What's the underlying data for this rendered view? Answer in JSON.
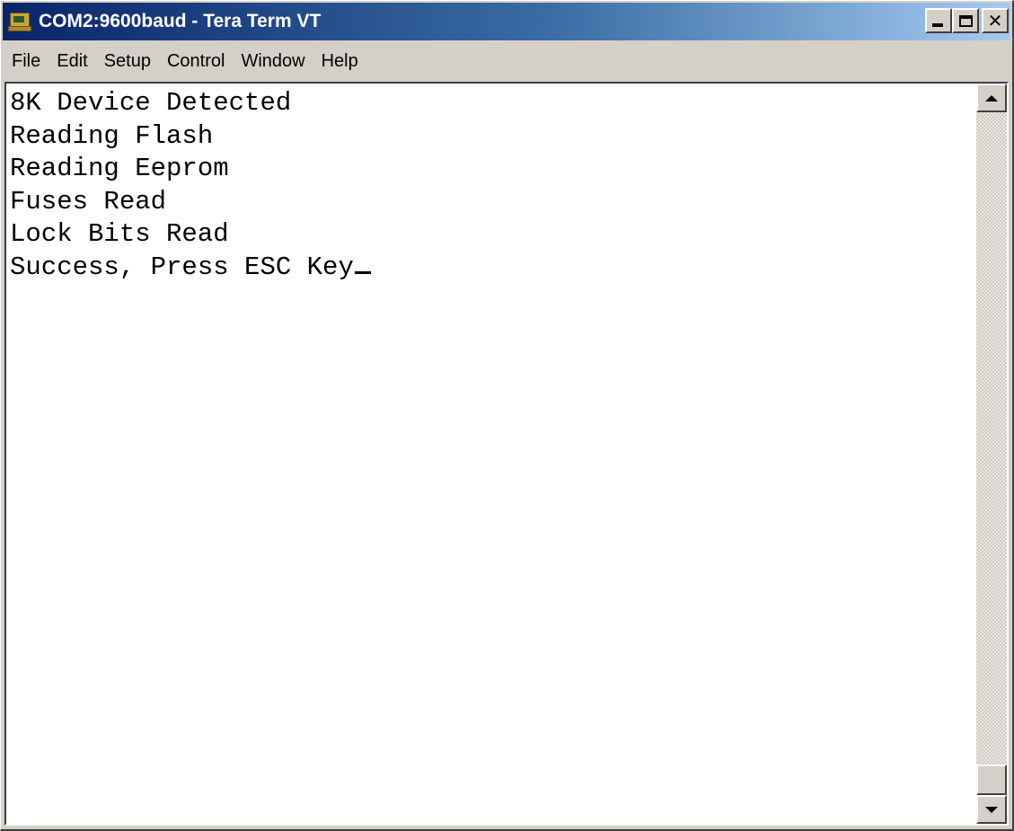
{
  "window": {
    "title": "COM2:9600baud - Tera Term VT",
    "icon": "tera-term-icon",
    "controls": {
      "minimize": "minimize-icon",
      "maximize": "maximize-icon",
      "close": "close-icon",
      "close_glyph": "✕"
    }
  },
  "menu": {
    "items": [
      {
        "label": "File"
      },
      {
        "label": "Edit"
      },
      {
        "label": "Setup"
      },
      {
        "label": "Control"
      },
      {
        "label": "Window"
      },
      {
        "label": "Help"
      }
    ]
  },
  "terminal": {
    "lines": [
      "8K Device Detected",
      "Reading Flash",
      "Reading Eeprom",
      "Fuses Read",
      "Lock Bits Read",
      "Success, Press ESC Key"
    ],
    "cursor": "underline-cursor"
  },
  "scrollbar": {
    "position": 1.0,
    "up": "scroll-up-arrow-icon",
    "down": "scroll-down-arrow-icon"
  },
  "colors": {
    "title_gradient_start": "#0a246a",
    "title_gradient_end": "#a6caf0",
    "chrome": "#d4d0c8",
    "terminal_bg": "#ffffff",
    "terminal_fg": "#000000"
  }
}
